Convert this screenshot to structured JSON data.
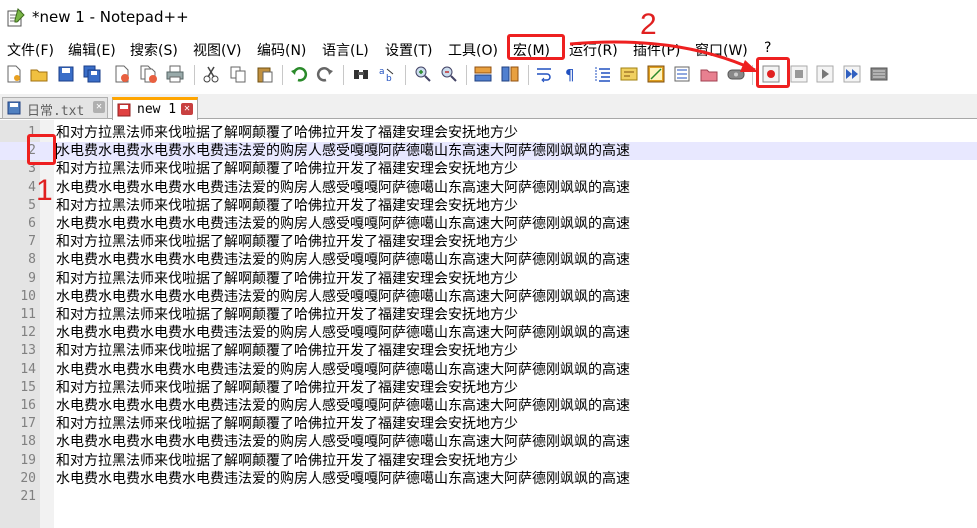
{
  "window": {
    "title": "*new 1 - Notepad++"
  },
  "menu": [
    {
      "label": "文件(F)"
    },
    {
      "label": "编辑(E)"
    },
    {
      "label": "搜索(S)"
    },
    {
      "label": "视图(V)"
    },
    {
      "label": "编码(N)"
    },
    {
      "label": "语言(L)"
    },
    {
      "label": "设置(T)"
    },
    {
      "label": "工具(O)"
    },
    {
      "label": "宏(M)"
    },
    {
      "label": "运行(R)"
    },
    {
      "label": "插件(P)"
    },
    {
      "label": "窗口(W)"
    },
    {
      "label": "?"
    }
  ],
  "toolbar": {
    "icons": [
      "new-file-icon",
      "open-file-icon",
      "save-icon",
      "save-all-icon",
      "close-icon",
      "close-all-icon",
      "print-icon",
      "cut-icon",
      "copy-icon",
      "paste-icon",
      "undo-icon",
      "redo-icon",
      "find-icon",
      "replace-icon",
      "zoom-in-icon",
      "zoom-out-icon",
      "sync-vertical-icon",
      "sync-horizontal-icon",
      "word-wrap-icon",
      "show-all-characters-icon",
      "indent-guide-icon",
      "user-defined-language-icon",
      "document-map-icon",
      "function-list-icon",
      "folder-as-workspace-icon",
      "monitoring-icon",
      "start-recording-icon",
      "stop-recording-icon",
      "playback-icon",
      "run-macro-multiple-icon",
      "save-macro-icon"
    ]
  },
  "tabs": [
    {
      "label": "日常.txt",
      "active": false
    },
    {
      "label": "new 1",
      "active": true
    }
  ],
  "editor": {
    "current_line": 2,
    "lines": [
      "和对方拉黑法师来伐啦据了解啊颠覆了哈佛拉开发了福建安理会安抚地方少",
      "水电费水电费水电费水电费违法爱的购房人感受嘎嘎阿萨德噶山东高速大阿萨德刚飒飒的高速",
      "和对方拉黑法师来伐啦据了解啊颠覆了哈佛拉开发了福建安理会安抚地方少",
      "水电费水电费水电费水电费违法爱的购房人感受嘎嘎阿萨德噶山东高速大阿萨德刚飒飒的高速",
      "和对方拉黑法师来伐啦据了解啊颠覆了哈佛拉开发了福建安理会安抚地方少",
      "水电费水电费水电费水电费违法爱的购房人感受嘎嘎阿萨德噶山东高速大阿萨德刚飒飒的高速",
      "和对方拉黑法师来伐啦据了解啊颠覆了哈佛拉开发了福建安理会安抚地方少",
      "水电费水电费水电费水电费违法爱的购房人感受嘎嘎阿萨德噶山东高速大阿萨德刚飒飒的高速",
      "和对方拉黑法师来伐啦据了解啊颠覆了哈佛拉开发了福建安理会安抚地方少",
      "水电费水电费水电费水电费违法爱的购房人感受嘎嘎阿萨德噶山东高速大阿萨德刚飒飒的高速",
      "和对方拉黑法师来伐啦据了解啊颠覆了哈佛拉开发了福建安理会安抚地方少",
      "水电费水电费水电费水电费违法爱的购房人感受嘎嘎阿萨德噶山东高速大阿萨德刚飒飒的高速",
      "和对方拉黑法师来伐啦据了解啊颠覆了哈佛拉开发了福建安理会安抚地方少",
      "水电费水电费水电费水电费违法爱的购房人感受嘎嘎阿萨德噶山东高速大阿萨德刚飒飒的高速",
      "和对方拉黑法师来伐啦据了解啊颠覆了哈佛拉开发了福建安理会安抚地方少",
      "水电费水电费水电费水电费违法爱的购房人感受嘎嘎阿萨德噶山东高速大阿萨德刚飒飒的高速",
      "和对方拉黑法师来伐啦据了解啊颠覆了哈佛拉开发了福建安理会安抚地方少",
      "水电费水电费水电费水电费违法爱的购房人感受嘎嘎阿萨德噶山东高速大阿萨德刚飒飒的高速",
      "和对方拉黑法师来伐啦据了解啊颠覆了哈佛拉开发了福建安理会安抚地方少",
      "水电费水电费水电费水电费违法爱的购房人感受嘎嘎阿萨德噶山东高速大阿萨德刚飒飒的高速",
      ""
    ]
  },
  "annotations": {
    "marker_1": "1",
    "marker_2": "2",
    "color": "#ee2020"
  },
  "colors": {
    "active_tab_accent": "#ffa500",
    "current_line": "#e8e8ff",
    "gutter": "#e4e4e4"
  }
}
